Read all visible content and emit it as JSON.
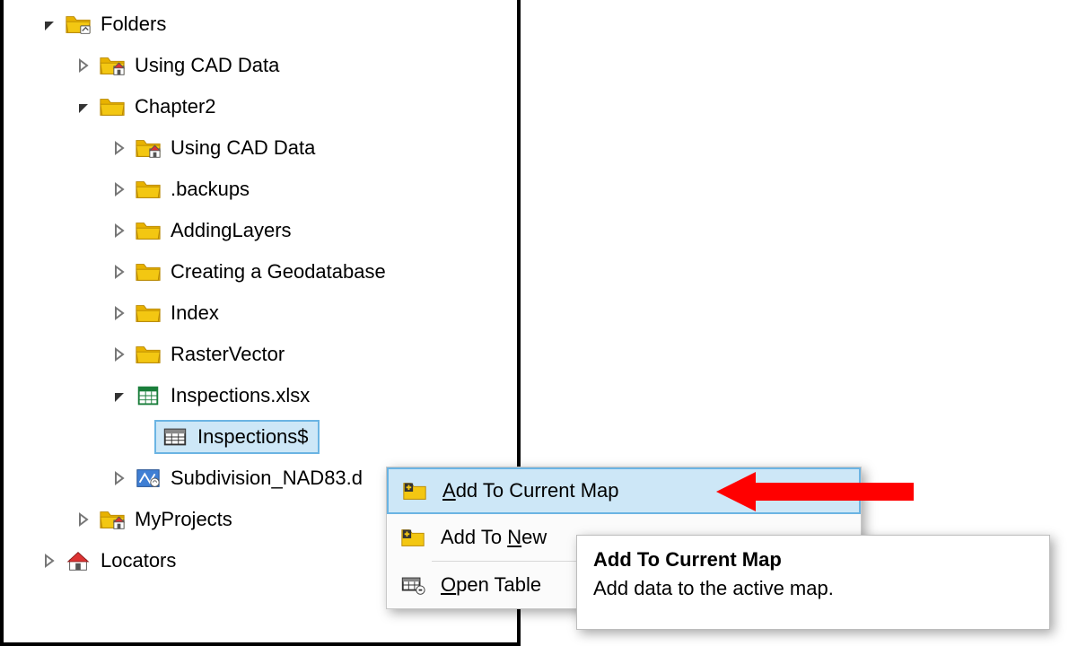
{
  "tree": {
    "folders_label": "Folders",
    "using_cad_data": "Using CAD Data",
    "chapter2": "Chapter2",
    "chapter2_children": {
      "using_cad_data": "Using CAD Data",
      "backups": ".backups",
      "adding_layers": "AddingLayers",
      "creating_gdb": "Creating a Geodatabase",
      "index": "Index",
      "raster_vector": "RasterVector",
      "inspections_xlsx": "Inspections.xlsx",
      "inspections_sheet": "Inspections$",
      "subdivision": "Subdivision_NAD83.d"
    },
    "my_projects": "MyProjects",
    "locators": "Locators"
  },
  "menu": {
    "add_current_map_pre": "",
    "add_current_map_u": "A",
    "add_current_map_post": "dd To Current Map",
    "add_new_pre": "Add To ",
    "add_new_u": "N",
    "add_new_post": "ew",
    "open_table_pre": "",
    "open_table_u": "O",
    "open_table_post": "pen Table"
  },
  "tooltip": {
    "title": "Add To Current Map",
    "body": "Add data to the active map."
  }
}
